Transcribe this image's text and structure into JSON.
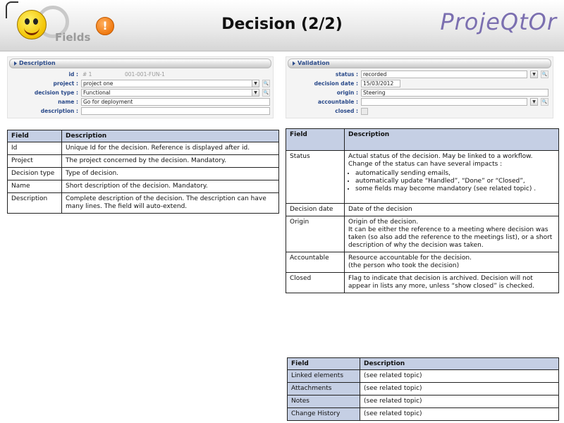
{
  "header": {
    "logo_text": "Fields",
    "warning_symbol": "!",
    "title": "Decision (2/2)",
    "brand": "ProjeQtOr"
  },
  "description_panel": {
    "section_label": "Description",
    "fields": {
      "id_label": "id :",
      "id_value": "# 1",
      "id_reference": "001-001-FUN-1",
      "project_label": "project :",
      "project_value": "project one",
      "decision_type_label": "decision type :",
      "decision_type_value": "Functional",
      "name_label": "name :",
      "name_value": "Go for deployment",
      "description_label": "description :",
      "description_value": ""
    }
  },
  "validation_panel": {
    "section_label": "Validation",
    "fields": {
      "status_label": "status :",
      "status_value": "recorded",
      "decision_date_label": "decision date :",
      "decision_date_value": "15/03/2012",
      "origin_label": "origin :",
      "origin_value": "Steering",
      "accountable_label": "accountable :",
      "accountable_value": "",
      "closed_label": "closed :"
    }
  },
  "table_left": {
    "headers": [
      "Field",
      "Description"
    ],
    "rows": [
      [
        "Id",
        "Unique Id for the decision. Reference is displayed after id."
      ],
      [
        "Project",
        "The project concerned by the decision. Mandatory."
      ],
      [
        "Decision type",
        "Type of decision."
      ],
      [
        "Name",
        "Short description of the decision. Mandatory."
      ],
      [
        "Description",
        "Complete description of the decision. The description can have many lines. The field will auto-extend."
      ]
    ]
  },
  "table_right": {
    "headers": [
      "Field",
      "Description"
    ],
    "status": {
      "field": "Status",
      "line1": "Actual status of the decision. May be linked to a workflow.",
      "line2": "Change of the status can have several impacts :",
      "bullets": [
        "automatically sending emails,",
        "automatically update “Handled”, “Done” or “Closed”,",
        "some fields may become mandatory (see related topic) ."
      ]
    },
    "rows": [
      [
        "Decision date",
        "Date of the decision"
      ],
      [
        "Origin",
        "Origin of the decision.\nIt can be either the reference to a meeting where decision was taken (so also add the reference to the meetings list), or a short description of why the decision was taken."
      ],
      [
        "Accountable",
        "Resource accountable for the decision.\n(the person who took the decision)"
      ],
      [
        "Closed",
        "Flag to indicate that decision is archived. Decision will not appear in lists any more, unless “show closed” is checked."
      ]
    ]
  },
  "table_bottom": {
    "headers": [
      "Field",
      "Description"
    ],
    "rows": [
      [
        "Linked elements",
        "(see related topic)"
      ],
      [
        "Attachments",
        "(see related topic)"
      ],
      [
        "Notes",
        "(see related topic)"
      ],
      [
        "Change History",
        "(see related topic)"
      ]
    ]
  },
  "colors": {
    "header_fill": "#c5cfe4",
    "label_blue": "#2a4a8a",
    "brand_purple": "#7b6fb0"
  }
}
